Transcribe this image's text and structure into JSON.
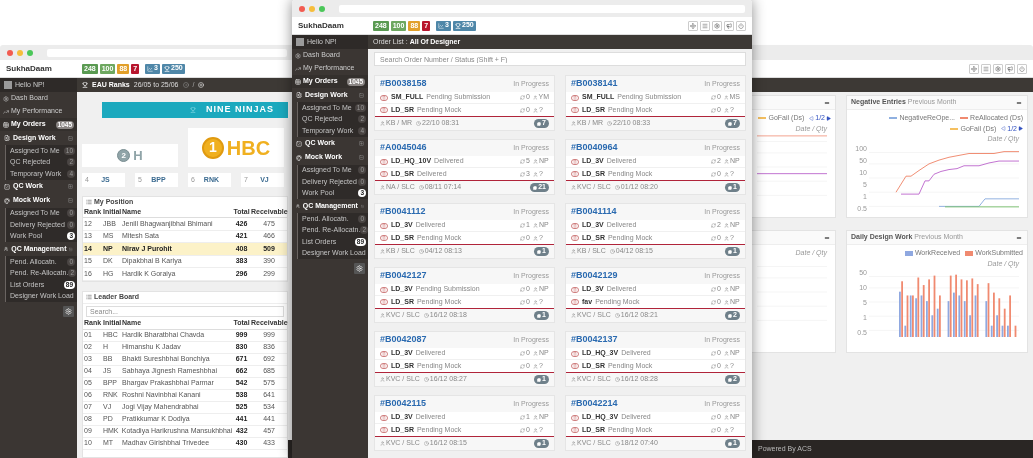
{
  "back_window": {
    "header": {
      "brand": "SukhaDaam",
      "counters": [
        {
          "text": "248",
          "color": "#5a9a52"
        },
        {
          "text": "100",
          "color": "#6ea860"
        },
        {
          "text": "88",
          "color": "#e2a02a"
        },
        {
          "text": "7",
          "color": "#b8162e"
        }
      ],
      "stats": [
        {
          "kind": "chart",
          "text": "3"
        },
        {
          "kind": "trophy",
          "text": "250"
        }
      ]
    },
    "sidebar": {
      "greeting": "Hello NP!",
      "items": [
        {
          "kind": "link",
          "label": "Dash Board",
          "selected": false
        },
        {
          "kind": "link",
          "label": "My Performance",
          "selected": false
        },
        {
          "kind": "link",
          "label": "My Orders",
          "badge": "1045",
          "selected": true
        },
        {
          "kind": "group",
          "label": "Design Work",
          "expanded": true,
          "children": [
            {
              "label": "Assigned To Me",
              "badge": "10",
              "highlighted": false
            },
            {
              "label": "QC Rejected",
              "badge": "2",
              "highlighted": false
            },
            {
              "label": "Temporary Work",
              "badge": "4",
              "highlighted": false
            }
          ]
        },
        {
          "kind": "group",
          "label": "QC Work",
          "expanded": false
        },
        {
          "kind": "group",
          "label": "Mock Work",
          "expanded": true,
          "children": [
            {
              "label": "Assigned To Me",
              "badge": "0",
              "highlighted": false
            },
            {
              "label": "Delivery Rejected",
              "badge": "0",
              "highlighted": false
            },
            {
              "label": "Work Pool",
              "badge": "3",
              "highlighted": true
            }
          ]
        },
        {
          "kind": "group",
          "label": "QC Management",
          "expanded": true,
          "children": [
            {
              "label": "Pend. Allocatn.",
              "badge": "0",
              "highlighted": false
            },
            {
              "label": "Pend. Re-Allocatn.",
              "badge": "2",
              "highlighted": false
            },
            {
              "label": "List Orders",
              "badge": "89",
              "highlighted": true
            },
            {
              "label": "Designer Work Load"
            }
          ]
        }
      ]
    },
    "page_header": {
      "title": "EAU Ranks",
      "period": "26/05 to 25/06",
      "separator": "/"
    },
    "banner": "NINE NINJAS",
    "podium": [
      {
        "kind": "silver",
        "rank": "2",
        "initial": "H"
      },
      {
        "kind": "gold",
        "rank": "1",
        "initial": "HBC"
      }
    ],
    "ranks": [
      {
        "rank": "4",
        "initial": "JS"
      },
      {
        "rank": "5",
        "initial": "BPP"
      },
      {
        "rank": "6",
        "initial": "RNK"
      },
      {
        "rank": "7",
        "initial": "VJ"
      }
    ],
    "my_position": {
      "title": "My Position",
      "columns": [
        "Rank",
        "Initial",
        "Name",
        "Total",
        "Receivable"
      ],
      "rows": [
        {
          "cells": [
            "12",
            "JBB",
            "Jenill Bhagwanjibhai Bhimani",
            "426",
            "475"
          ],
          "selected": false
        },
        {
          "cells": [
            "13",
            "MS",
            "Mitesh Sata",
            "421",
            "466"
          ],
          "selected": false
        },
        {
          "cells": [
            "14",
            "NP",
            "Nirav J Purohit",
            "408",
            "509"
          ],
          "selected": true
        },
        {
          "cells": [
            "15",
            "DK",
            "Dipakbhai B Kariya",
            "383",
            "390"
          ],
          "selected": false
        },
        {
          "cells": [
            "16",
            "HG",
            "Hardik K Goraiya",
            "296",
            "299"
          ],
          "selected": false
        }
      ]
    },
    "leader_board": {
      "title": "Leader Board",
      "search_placeholder": "Search...",
      "columns": [
        "Rank",
        "Initial",
        "Name",
        "Total",
        "Receivable"
      ],
      "rows": [
        [
          "01",
          "HBC",
          "Hardik Bharatbhai Chavda",
          "999",
          "999"
        ],
        [
          "02",
          "H",
          "Himanshu K Jadav",
          "830",
          "836"
        ],
        [
          "03",
          "BB",
          "Bhakti Sureshbhai Bonchiya",
          "671",
          "692"
        ],
        [
          "04",
          "JS",
          "Sabhaya Jignesh Rameshbhai",
          "662",
          "685"
        ],
        [
          "05",
          "BPP",
          "Bhargav Prakashbhai Parmar",
          "542",
          "575"
        ],
        [
          "06",
          "RNK",
          "Roshni Navinbhai Kanani",
          "538",
          "641"
        ],
        [
          "07",
          "VJ",
          "Jogi Vijay Mahendrabhai",
          "525",
          "534"
        ],
        [
          "08",
          "PD",
          "Pratikkumar K Dodiya",
          "441",
          "441"
        ],
        [
          "09",
          "HMK",
          "Kotadiya Harikrushna Mansukhbhai",
          "432",
          "457"
        ],
        [
          "10",
          "MT",
          "Madhav Girishbhai Trivedee",
          "430",
          "433"
        ]
      ]
    },
    "charts_middle": [
      {
        "kind": "flat",
        "legend": [
          {
            "label": "GoFail (Ds)",
            "color": "#f5c060"
          }
        ],
        "pager": "1/2",
        "axis_label": "Date / Qty"
      },
      {
        "kind": "grid",
        "axis_label": "Date / Qty"
      }
    ],
    "charts_right": [
      {
        "kind": "line",
        "title": "Negative Entries",
        "subtitle": "Previous Month",
        "legend": [
          {
            "label": "NegativeReOpe...",
            "color": "#8fb0e0"
          },
          {
            "label": "ReAllocated (Ds)",
            "color": "#f08a70"
          },
          {
            "label": "GoFail (Ds)",
            "color": "#f5c060"
          }
        ],
        "pager": "1/2",
        "y_ticks": [
          "100",
          "50",
          "10",
          "5",
          "1",
          "0.5"
        ],
        "axis_label": "Date / Qty"
      },
      {
        "kind": "bar",
        "title": "Daily Design Work",
        "subtitle": "Previous Month",
        "legend": [
          {
            "label": "WorkReceived",
            "color": "#8fa8e0"
          },
          {
            "label": "WorkSubmitted",
            "color": "#f08a70"
          }
        ],
        "y_ticks": [
          "50",
          "10",
          "5",
          "1",
          "0.5"
        ],
        "axis_label": "Date / Qty"
      }
    ],
    "footer": "Powered By ACS"
  },
  "front_window": {
    "header": {
      "brand": "SukhaDaam",
      "counters": [
        {
          "text": "248",
          "color": "#5a9a52"
        },
        {
          "text": "100",
          "color": "#6ea860"
        },
        {
          "text": "88",
          "color": "#e2a02a"
        },
        {
          "text": "7",
          "color": "#b8162e"
        }
      ],
      "stats": [
        {
          "kind": "chart",
          "text": "3"
        },
        {
          "kind": "trophy",
          "text": "250"
        }
      ]
    },
    "sidebar": {
      "greeting": "Hello NP!",
      "items": [
        {
          "kind": "link",
          "label": "Dash Board",
          "selected": false
        },
        {
          "kind": "link",
          "label": "My Performance",
          "selected": false
        },
        {
          "kind": "link",
          "label": "My Orders",
          "badge": "1045",
          "selected": true
        },
        {
          "kind": "group",
          "label": "Design Work",
          "expanded": true,
          "children": [
            {
              "label": "Assigned To Me",
              "badge": "10",
              "highlighted": false
            },
            {
              "label": "QC Rejected",
              "badge": "2",
              "highlighted": false
            },
            {
              "label": "Temporary Work",
              "badge": "4",
              "highlighted": false
            }
          ]
        },
        {
          "kind": "group",
          "label": "QC Work",
          "expanded": false
        },
        {
          "kind": "group",
          "label": "Mock Work",
          "expanded": true,
          "children": [
            {
              "label": "Assigned To Me",
              "badge": "0",
              "highlighted": false
            },
            {
              "label": "Delivery Rejected",
              "badge": "0",
              "highlighted": false
            },
            {
              "label": "Work Pool",
              "badge": "3",
              "highlighted": true
            }
          ]
        },
        {
          "kind": "group",
          "label": "QC Management",
          "expanded": true,
          "children": [
            {
              "label": "Pend. Allocatn.",
              "badge": "0",
              "highlighted": false
            },
            {
              "label": "Pend. Re-Allocatn.",
              "badge": "2",
              "highlighted": false
            },
            {
              "label": "List Orders",
              "badge": "89",
              "highlighted": true
            },
            {
              "label": "Designer Work Load"
            }
          ]
        }
      ]
    },
    "page_header": {
      "label": "Order List :",
      "value": "All Of Designer"
    },
    "search": {
      "placeholder": "Search Order Number / Status (Shift + F)"
    },
    "orders": [
      {
        "number": "#B0038158",
        "status": "In Progress",
        "tasks": [
          {
            "code": "SM_FULL",
            "status": "Pending Submission",
            "count": "0",
            "user": "YM"
          },
          {
            "code": "LD_SR",
            "status": "Pending Mock",
            "count": "0",
            "user": "?"
          }
        ],
        "owner": "KB / MR",
        "time": "22/10 08:31",
        "comments": "7"
      },
      {
        "number": "#B0038141",
        "status": "In Progress",
        "tasks": [
          {
            "code": "SM_FULL",
            "status": "Pending Submission",
            "count": "0",
            "user": "MS"
          },
          {
            "code": "LD_SR",
            "status": "Pending Mock",
            "count": "0",
            "user": "?"
          }
        ],
        "owner": "KB / MR",
        "time": "22/10 08:33",
        "comments": "7"
      },
      {
        "number": "#A0045046",
        "status": "In Progress",
        "tasks": [
          {
            "code": "LD_HQ_10V",
            "status": "Delivered",
            "count": "5",
            "user": "NP"
          },
          {
            "code": "LD_SR",
            "status": "Delivered",
            "count": "3",
            "user": "?"
          }
        ],
        "owner": "NA / SLC",
        "time": "08/11 07:14",
        "comments": "21"
      },
      {
        "number": "#B0040964",
        "status": "In Progress",
        "tasks": [
          {
            "code": "LD_3V",
            "status": "Delivered",
            "count": "2",
            "user": "NP"
          },
          {
            "code": "LD_SR",
            "status": "Pending Mock",
            "count": "0",
            "user": "?"
          }
        ],
        "owner": "KVC / SLC",
        "time": "01/12 08:20",
        "comments": "1"
      },
      {
        "number": "#B0041112",
        "status": "In Progress",
        "tasks": [
          {
            "code": "LD_3V",
            "status": "Delivered",
            "count": "1",
            "user": "NP"
          },
          {
            "code": "LD_SR",
            "status": "Pending Mock",
            "count": "0",
            "user": "?"
          }
        ],
        "owner": "KB / SLC",
        "time": "04/12 08:13",
        "comments": "1"
      },
      {
        "number": "#B0041114",
        "status": "In Progress",
        "tasks": [
          {
            "code": "LD_3V",
            "status": "Delivered",
            "count": "2",
            "user": "NP"
          },
          {
            "code": "LD_SR",
            "status": "Pending Mock",
            "count": "0",
            "user": "?"
          }
        ],
        "owner": "KB / SLC",
        "time": "04/12 08:15",
        "comments": "1"
      },
      {
        "number": "#B0042127",
        "status": "In Progress",
        "tasks": [
          {
            "code": "LD_3V",
            "status": "Pending Submission",
            "count": "0",
            "user": "NP"
          },
          {
            "code": "LD_SR",
            "status": "Pending Mock",
            "count": "0",
            "user": "?"
          }
        ],
        "owner": "KVC / SLC",
        "time": "16/12 08:18",
        "comments": "1"
      },
      {
        "number": "#B0042129",
        "status": "In Progress",
        "tasks": [
          {
            "code": "LD_3V",
            "status": "Delivered",
            "count": "0",
            "user": "NP"
          },
          {
            "code": "fav",
            "status": "Pending Mock",
            "count": "0",
            "user": "NP"
          }
        ],
        "owner": "KVC / SLC",
        "time": "16/12 08:21",
        "comments": "2"
      },
      {
        "number": "#B0042087",
        "status": "In Progress",
        "tasks": [
          {
            "code": "LD_3V",
            "status": "Delivered",
            "count": "0",
            "user": "NP"
          },
          {
            "code": "LD_SR",
            "status": "Pending Mock",
            "count": "0",
            "user": "?"
          }
        ],
        "owner": "KVC / SLC",
        "time": "16/12 08:27",
        "comments": "1"
      },
      {
        "number": "#B0042137",
        "status": "In Progress",
        "tasks": [
          {
            "code": "LD_HQ_3V",
            "status": "Delivered",
            "count": "0",
            "user": "NP"
          },
          {
            "code": "LD_SR",
            "status": "Pending Mock",
            "count": "0",
            "user": "?"
          }
        ],
        "owner": "KVC / SLC",
        "time": "16/12 08:28",
        "comments": "2"
      },
      {
        "number": "#B0042115",
        "status": "In Progress",
        "tasks": [
          {
            "code": "LD_3V",
            "status": "Delivered",
            "count": "1",
            "user": "NP"
          },
          {
            "code": "LD_SR",
            "status": "Pending Mock",
            "count": "0",
            "user": "?"
          }
        ],
        "owner": "KVC / SLC",
        "time": "16/12 08:15",
        "comments": "1"
      },
      {
        "number": "#B0042214",
        "status": "In Progress",
        "tasks": [
          {
            "code": "LD_HQ_3V",
            "status": "Delivered",
            "count": "0",
            "user": "NP"
          },
          {
            "code": "LD_SR",
            "status": "Pending Mock",
            "count": "0",
            "user": "?"
          }
        ],
        "owner": "KVC / SLC",
        "time": "18/12 07:40",
        "comments": "1"
      }
    ]
  }
}
